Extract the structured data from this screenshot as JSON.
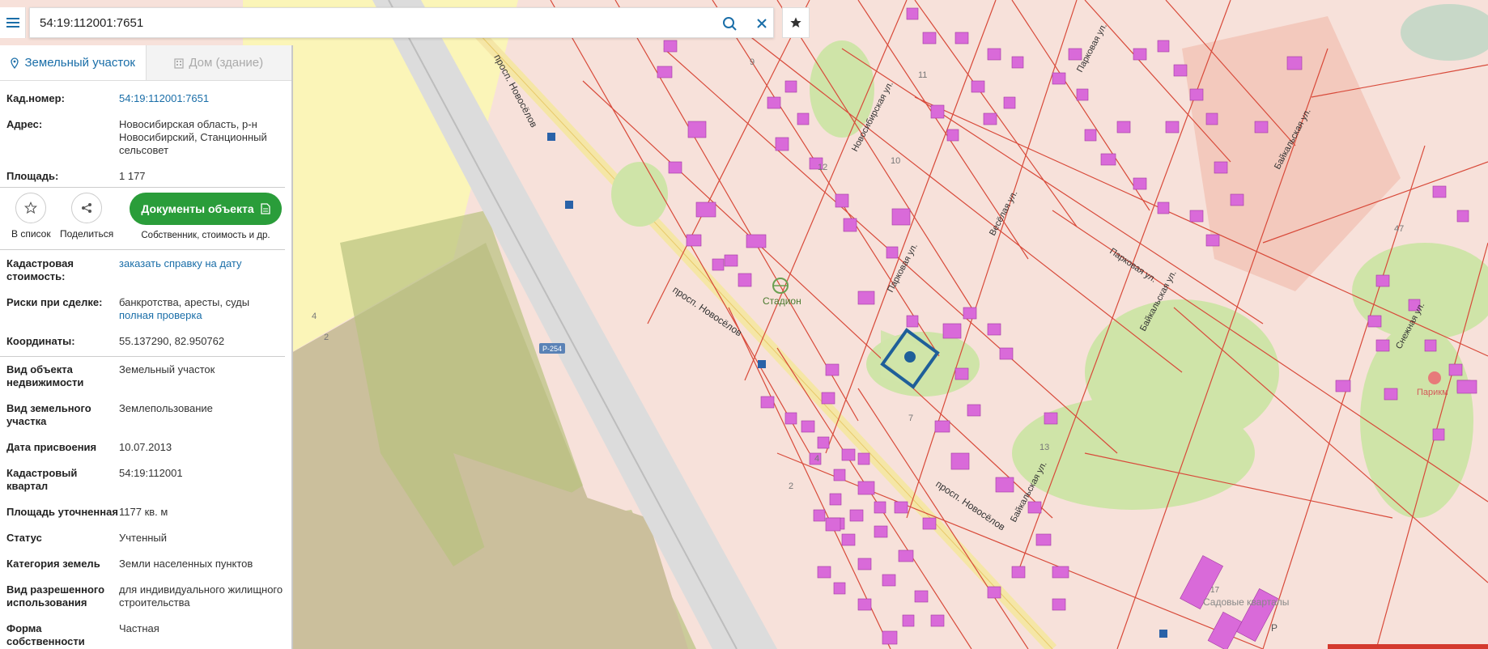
{
  "search": {
    "value": "54:19:112001:7651"
  },
  "tabs": [
    {
      "label": "Земельный участок",
      "active": true
    },
    {
      "label": "Дом (здание)",
      "active": false
    }
  ],
  "info_top": [
    {
      "key": "Кад.номер:",
      "value": "54:19:112001:7651",
      "link": true
    },
    {
      "key": "Адрес:",
      "value": "Новосибирская область, р-н Новосибирский, Станционный сельсовет"
    },
    {
      "key": "Площадь:",
      "value": "1 177"
    }
  ],
  "actions": {
    "to_list": "В список",
    "share": "Поделиться",
    "docs_button": "Документы объекта",
    "docs_sub": "Собственник, стоимость и др."
  },
  "info_mid": {
    "cad_cost_key": "Кадастровая стоимость:",
    "cad_cost_link": "заказать справку на дату",
    "risks_key": "Риски при сделке:",
    "risks_value": "банкротства, аресты, суды",
    "risks_link": "полная проверка",
    "coords_key": "Координаты:",
    "coords_value": "55.137290, 82.950762"
  },
  "info_bottom": [
    {
      "key": "Вид объекта недвижимости",
      "value": "Земельный участок"
    },
    {
      "key": "Вид земельного участка",
      "value": "Землепользование"
    },
    {
      "key": "Дата присвоения",
      "value": "10.07.2013"
    },
    {
      "key": "Кадастровый квартал",
      "value": "54:19:112001"
    },
    {
      "key": "Площадь уточненная",
      "value": "1177 кв. м"
    },
    {
      "key": "Статус",
      "value": "Учтенный"
    },
    {
      "key": "Категория земель",
      "value": "Земли населенных пунктов"
    },
    {
      "key": "Вид разрешенного использования",
      "value": "для индивидуального жилищного строительства"
    },
    {
      "key": "Форма собственности",
      "value": "Частная"
    }
  ],
  "map": {
    "labels": [
      {
        "text": "просп. Новосёлов",
        "name": "street-label-novoselov-1"
      },
      {
        "text": "просп. Новосёлов",
        "name": "street-label-novoselov-2"
      },
      {
        "text": "просп. Новосёлов",
        "name": "street-label-novoselov-3"
      },
      {
        "text": "Новосибирская ул.",
        "name": "street-label-novosibirskaya"
      },
      {
        "text": "Парковая ул.",
        "name": "street-label-parkovaya-1"
      },
      {
        "text": "Парковая ул.",
        "name": "street-label-parkovaya-2"
      },
      {
        "text": "Парковая ул.",
        "name": "street-label-parkovaya-3"
      },
      {
        "text": "Весёлая ул.",
        "name": "street-label-veselaya"
      },
      {
        "text": "Байкальская ул.",
        "name": "street-label-baikalskaya-1"
      },
      {
        "text": "Байкальская ул.",
        "name": "street-label-baikalskaya-2"
      },
      {
        "text": "Байкальская ул.",
        "name": "street-label-baikalskaya-3"
      },
      {
        "text": "Снежная ул.",
        "name": "street-label-snezhnaya"
      },
      {
        "text": "Стадион",
        "name": "poi-label-stadium"
      },
      {
        "text": "Садовые кварталы",
        "name": "poi-label-sadovye"
      },
      {
        "text": "Р-254",
        "name": "road-label-r254"
      },
      {
        "text": "Парикм",
        "name": "poi-label-parikm"
      }
    ],
    "numbers": [
      "9",
      "11",
      "10",
      "12",
      "7",
      "13",
      "4",
      "2",
      "47",
      "17",
      "4",
      "2",
      "P"
    ],
    "colors": {
      "highlight": "#1f5f99",
      "lots_bg": "#f7e1da",
      "lot_border": "#d84a3a",
      "building": "#d96ad9",
      "road": "#f5e6a6",
      "green": "#cfe4a8",
      "sand": "#cbbf9c"
    }
  }
}
